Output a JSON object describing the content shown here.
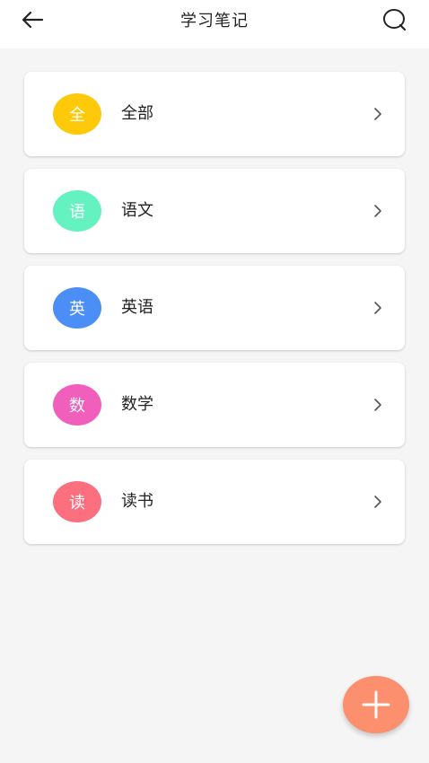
{
  "header": {
    "title": "学习笔记",
    "back_icon": "arrow-left-icon",
    "search_icon": "search-icon"
  },
  "categories": [
    {
      "badge": "全",
      "label": "全部",
      "color": "#fdc909"
    },
    {
      "badge": "语",
      "label": "语文",
      "color": "#63f2c0"
    },
    {
      "badge": "英",
      "label": "英语",
      "color": "#4a8ef6"
    },
    {
      "badge": "数",
      "label": "数学",
      "color": "#f15fbd"
    },
    {
      "badge": "读",
      "label": "读书",
      "color": "#fb6f7f"
    }
  ],
  "fab": {
    "icon": "plus-icon",
    "color": "#fc8f6e"
  }
}
